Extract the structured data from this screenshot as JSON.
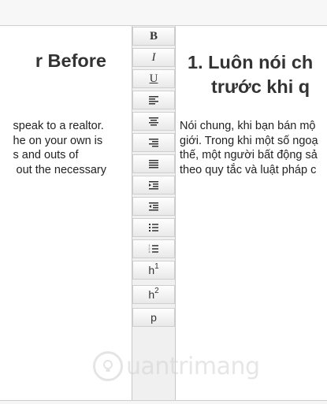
{
  "left_pane": {
    "heading": "r Before",
    "body": "speak to a realtor.\nhe on your own is\ns and outs of\n out the necessary"
  },
  "right_pane": {
    "heading_line1": "1. Luôn nói ch",
    "heading_line2": "trước khi q",
    "body": "Nói chung, khi bạn bán mộ\ngiới. Trong khi một số ngoạ\nthế, một người bất động sả\ntheo quy tắc và luật pháp c"
  },
  "toolbar": {
    "bold": "B",
    "italic": "I",
    "underline": "U",
    "align_left_icon": "align-left-icon",
    "align_center_icon": "align-center-icon",
    "align_right_icon": "align-right-icon",
    "align_justify_icon": "align-justify-icon",
    "indent_icon": "indent-icon",
    "outdent_icon": "outdent-icon",
    "bullet_list_icon": "bullet-list-icon",
    "numbered_list_icon": "numbered-list-icon",
    "h1_label": "h",
    "h1_sup": "1",
    "h2_label": "h",
    "h2_sup": "2",
    "p_label": "p"
  },
  "watermark": {
    "text": "uantrimang"
  }
}
